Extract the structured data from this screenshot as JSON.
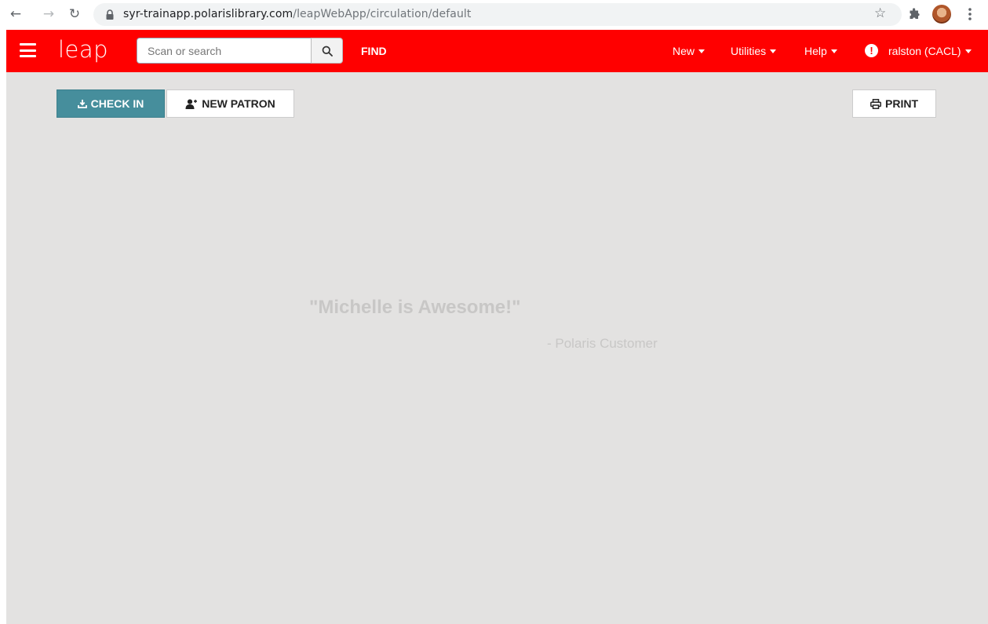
{
  "browser": {
    "url_host": "syr-trainapp.polarislibrary.com",
    "url_path": "/leapWebApp/circulation/default"
  },
  "navbar": {
    "logo": "leap",
    "search_placeholder": "Scan or search",
    "find_label": "FIND",
    "menus": {
      "new": "New",
      "utilities": "Utilities",
      "help": "Help",
      "user": "ralston (CACL)"
    },
    "alert_glyph": "!"
  },
  "toolbar": {
    "checkin_label": "CHECK IN",
    "newpatron_label": "NEW PATRON",
    "print_label": "PRINT"
  },
  "quote": {
    "text": "\"Michelle is Awesome!\"",
    "author": "- Polaris Customer"
  },
  "colors": {
    "navbar": "#ff0000",
    "checkin_button": "#468e9c",
    "background": "#e3e2e1"
  },
  "icons": {
    "back": "back-arrow-icon",
    "forward": "forward-arrow-icon",
    "reload": "reload-icon",
    "lock": "lock-icon",
    "star": "bookmark-star-icon",
    "extensions": "puzzle-icon",
    "menu": "kebab-icon",
    "search": "search-icon",
    "checkin": "download-icon",
    "newpatron": "user-plus-icon",
    "print": "printer-icon"
  }
}
